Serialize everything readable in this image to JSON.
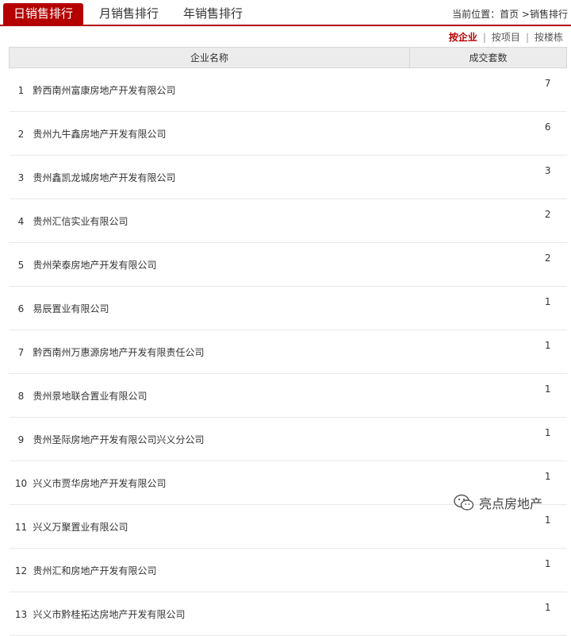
{
  "tabs": [
    {
      "label": "日销售排行"
    },
    {
      "label": "月销售排行"
    },
    {
      "label": "年销售排行"
    }
  ],
  "breadcrumb": {
    "prefix": "当前位置：",
    "home": "首页",
    "separator": " >",
    "current": "销售排行"
  },
  "filters": [
    {
      "label": "按企业"
    },
    {
      "label": "按项目"
    },
    {
      "label": "按楼栋"
    }
  ],
  "filter_separator": "|",
  "table": {
    "headers": [
      "企业名称",
      "成交套数"
    ],
    "rows": [
      {
        "rank": "1",
        "name": "黔西南州富康房地产开发有限公司",
        "count": "7"
      },
      {
        "rank": "2",
        "name": "贵州九牛鑫房地产开发有限公司",
        "count": "6"
      },
      {
        "rank": "3",
        "name": "贵州鑫凯龙城房地产开发有限公司",
        "count": "3"
      },
      {
        "rank": "4",
        "name": "贵州汇信实业有限公司",
        "count": "2"
      },
      {
        "rank": "5",
        "name": "贵州荣泰房地产开发有限公司",
        "count": "2"
      },
      {
        "rank": "6",
        "name": "易辰置业有限公司",
        "count": "1"
      },
      {
        "rank": "7",
        "name": "黔西南州万惠源房地产开发有限责任公司",
        "count": "1"
      },
      {
        "rank": "8",
        "name": "贵州景地联合置业有限公司",
        "count": "1"
      },
      {
        "rank": "9",
        "name": "贵州圣际房地产开发有限公司兴义分公司",
        "count": "1"
      },
      {
        "rank": "10",
        "name": "兴义市贾华房地产开发有限公司",
        "count": "1"
      },
      {
        "rank": "11",
        "name": "兴义万聚置业有限公司",
        "count": "1"
      },
      {
        "rank": "12",
        "name": "贵州汇和房地产开发有限公司",
        "count": "1"
      },
      {
        "rank": "13",
        "name": "兴义市黔桂拓达房地产开发有限公司",
        "count": "1"
      }
    ]
  },
  "watermark": {
    "text": "亮点房地产",
    "icon": "wechat-icon"
  },
  "colors": {
    "accent": "#b50000",
    "header_bg": "#ececec"
  }
}
